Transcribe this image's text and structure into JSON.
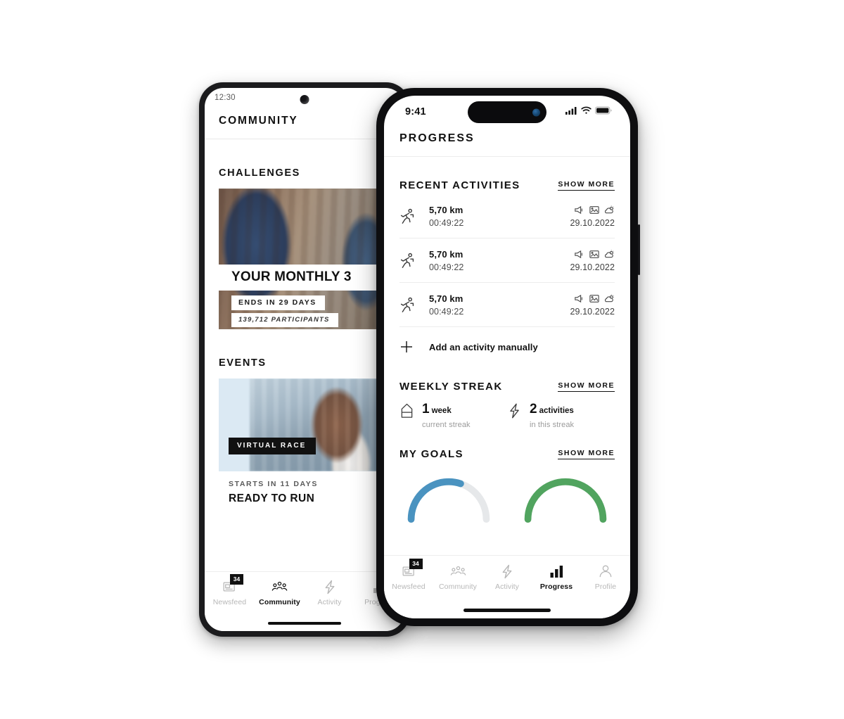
{
  "android": {
    "status": {
      "time": "12:30"
    },
    "app_title": "COMMUNITY",
    "sections": {
      "challenges_title": "CHALLENGES",
      "events_title": "EVENTS"
    },
    "challenge": {
      "title": "YOUR MONTHLY 3",
      "ends_in": "ENDS IN 29 DAYS",
      "participants": "139,712 PARTICIPANTS"
    },
    "event": {
      "tag": "VIRTUAL RACE",
      "starts_in": "STARTS IN 11 DAYS",
      "name": "READY TO RUN"
    },
    "nav": [
      {
        "label": "Newsfeed",
        "icon": "newsfeed-icon",
        "badge": "34",
        "active": false
      },
      {
        "label": "Community",
        "icon": "community-icon",
        "badge": "",
        "active": true
      },
      {
        "label": "Activity",
        "icon": "activity-icon",
        "badge": "",
        "active": false
      },
      {
        "label": "Progress",
        "icon": "progress-icon",
        "badge": "",
        "active": false
      }
    ]
  },
  "iphone": {
    "status": {
      "time": "9:41"
    },
    "app_title": "PROGRESS",
    "show_more_label": "SHOW MORE",
    "recent": {
      "title": "RECENT ACTIVITIES",
      "items": [
        {
          "distance": "5,70 km",
          "duration": "00:49:22",
          "date": "29.10.2022"
        },
        {
          "distance": "5,70 km",
          "duration": "00:49:22",
          "date": "29.10.2022"
        },
        {
          "distance": "5,70 km",
          "duration": "00:49:22",
          "date": "29.10.2022"
        }
      ],
      "add_label": "Add an activity manually"
    },
    "streak": {
      "title": "WEEKLY STREAK",
      "cells": [
        {
          "icon": "streak-arrow-icon",
          "value": "1",
          "unit": "week",
          "caption": "current streak"
        },
        {
          "icon": "bolt-icon",
          "value": "2",
          "unit": "activities",
          "caption": "in this streak"
        }
      ]
    },
    "goals": {
      "title": "MY GOALS",
      "arcs": [
        {
          "color": "#4a93c0",
          "track": "#e6e8ea",
          "progress": 60
        },
        {
          "color": "#51a45f",
          "track": "#e6e8ea",
          "progress": 100
        }
      ]
    },
    "nav": [
      {
        "label": "Newsfeed",
        "icon": "newsfeed-icon",
        "badge": "34",
        "active": false
      },
      {
        "label": "Community",
        "icon": "community-icon",
        "badge": "",
        "active": false
      },
      {
        "label": "Activity",
        "icon": "activity-icon",
        "badge": "",
        "active": false
      },
      {
        "label": "Progress",
        "icon": "progress-icon",
        "badge": "",
        "active": true
      },
      {
        "label": "Profile",
        "icon": "profile-icon",
        "badge": "",
        "active": false
      }
    ]
  }
}
